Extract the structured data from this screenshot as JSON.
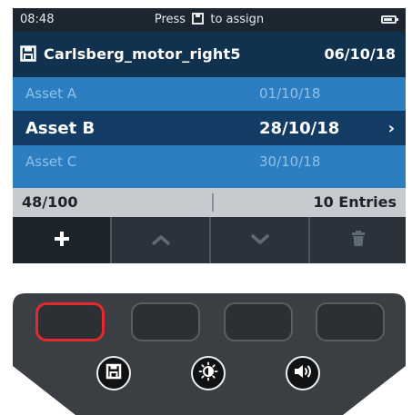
{
  "status": {
    "time": "08:48",
    "message_before": "Press",
    "message_after": "to assign",
    "battery_icon": "battery-icon"
  },
  "file": {
    "icon": "save-icon",
    "name": "Carlsberg_motor_right5",
    "date": "06/10/18"
  },
  "assets": [
    {
      "name": "Asset A",
      "date": "01/10/18",
      "selected": false
    },
    {
      "name": "Asset B",
      "date": "28/10/18",
      "selected": true
    },
    {
      "name": "Asset C",
      "date": "30/10/18",
      "selected": false
    }
  ],
  "selected_indicator": "›",
  "info": {
    "count": "48/100",
    "entries": "10 Entries"
  },
  "softkeys": [
    {
      "icon": "plus-icon",
      "active": true
    },
    {
      "icon": "chevron-up-icon",
      "active": false
    },
    {
      "icon": "chevron-down-icon",
      "active": false
    },
    {
      "icon": "trash-icon",
      "active": false
    }
  ],
  "keypad": {
    "buttons": [
      "save-icon",
      "brightness-icon",
      "volume-icon"
    ]
  },
  "colors": {
    "highlight_border": "#e3292e",
    "selected_row": "#123c63",
    "dim_row": "#2d7ec1"
  }
}
